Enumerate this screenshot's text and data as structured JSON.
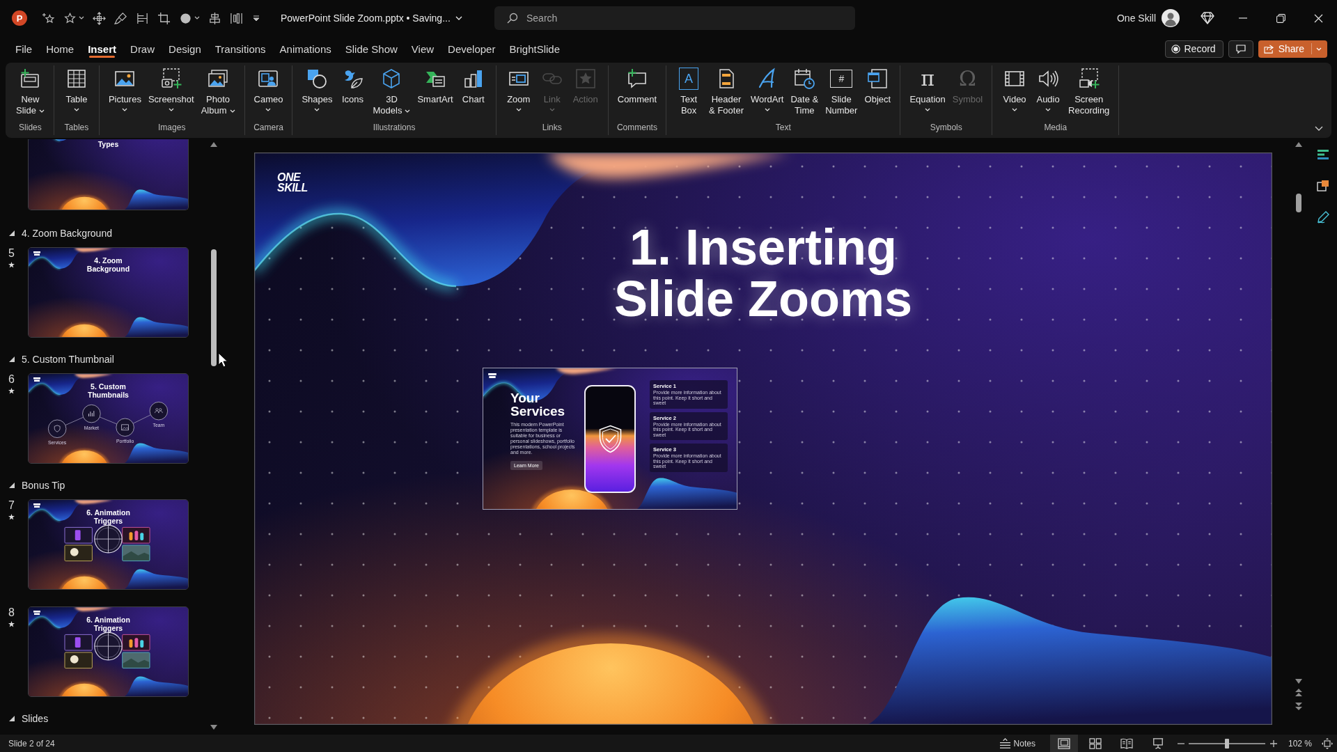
{
  "title_bar": {
    "app_logo": "P",
    "document_title": "PowerPoint Slide Zoom.pptx • Saving...",
    "search": {
      "placeholder": "Search"
    },
    "account_name": "One Skill"
  },
  "ribbon_tabs": [
    {
      "label": "File",
      "selected": false
    },
    {
      "label": "Home",
      "selected": false
    },
    {
      "label": "Insert",
      "selected": true
    },
    {
      "label": "Draw",
      "selected": false
    },
    {
      "label": "Design",
      "selected": false
    },
    {
      "label": "Transitions",
      "selected": false
    },
    {
      "label": "Animations",
      "selected": false
    },
    {
      "label": "Slide Show",
      "selected": false
    },
    {
      "label": "View",
      "selected": false
    },
    {
      "label": "Developer",
      "selected": false
    },
    {
      "label": "BrightSlide",
      "selected": false
    }
  ],
  "ribbon_actions": {
    "record": "Record",
    "share": "Share"
  },
  "ribbon": {
    "groups": [
      {
        "label": "Slides",
        "buttons": [
          {
            "kind": "newslide",
            "lines": [
              "New",
              "Slide"
            ],
            "dropdown": true,
            "disabled": false
          }
        ]
      },
      {
        "label": "Tables",
        "buttons": [
          {
            "kind": "table",
            "lines": [
              "Table"
            ],
            "dropdown": true,
            "disabled": false
          }
        ]
      },
      {
        "label": "Images",
        "buttons": [
          {
            "kind": "pictures",
            "lines": [
              "Pictures"
            ],
            "dropdown": true,
            "disabled": false
          },
          {
            "kind": "screenshot",
            "lines": [
              "Screenshot"
            ],
            "dropdown": true,
            "disabled": false
          },
          {
            "kind": "album",
            "lines": [
              "Photo",
              "Album"
            ],
            "dropdown": true,
            "disabled": false
          }
        ]
      },
      {
        "label": "Camera",
        "buttons": [
          {
            "kind": "cameo",
            "lines": [
              "Cameo"
            ],
            "dropdown": true,
            "disabled": false
          }
        ]
      },
      {
        "label": "Illustrations",
        "buttons": [
          {
            "kind": "shapes",
            "lines": [
              "Shapes"
            ],
            "dropdown": true,
            "disabled": false
          },
          {
            "kind": "icons",
            "lines": [
              "Icons"
            ],
            "dropdown": false,
            "disabled": false
          },
          {
            "kind": "models",
            "lines": [
              "3D",
              "Models"
            ],
            "dropdown": true,
            "disabled": false
          },
          {
            "kind": "smartart",
            "lines": [
              "SmartArt"
            ],
            "dropdown": false,
            "disabled": false
          },
          {
            "kind": "chart",
            "lines": [
              "Chart"
            ],
            "dropdown": false,
            "disabled": false
          }
        ]
      },
      {
        "label": "Links",
        "buttons": [
          {
            "kind": "zoom",
            "lines": [
              "Zoom"
            ],
            "dropdown": true,
            "disabled": false
          },
          {
            "kind": "link",
            "lines": [
              "Link"
            ],
            "dropdown": true,
            "disabled": true
          },
          {
            "kind": "action",
            "lines": [
              "Action"
            ],
            "dropdown": false,
            "disabled": true
          }
        ]
      },
      {
        "label": "Comments",
        "buttons": [
          {
            "kind": "comment",
            "lines": [
              "Comment"
            ],
            "dropdown": false,
            "disabled": false
          }
        ]
      },
      {
        "label": "Text",
        "buttons": [
          {
            "kind": "textbox",
            "glyph": "A",
            "lines": [
              "Text",
              "Box"
            ],
            "dropdown": false,
            "disabled": false
          },
          {
            "kind": "header",
            "lines": [
              "Header",
              "& Footer"
            ],
            "dropdown": false,
            "disabled": false
          },
          {
            "kind": "wordart",
            "lines": [
              "WordArt"
            ],
            "dropdown": true,
            "disabled": false
          },
          {
            "kind": "datetime",
            "lines": [
              "Date &",
              "Time"
            ],
            "dropdown": false,
            "disabled": false
          },
          {
            "kind": "slidenumber",
            "glyph": "#",
            "lines": [
              "Slide",
              "Number"
            ],
            "dropdown": false,
            "disabled": false
          },
          {
            "kind": "object",
            "lines": [
              "Object"
            ],
            "dropdown": false,
            "disabled": false
          }
        ]
      },
      {
        "label": "Symbols",
        "buttons": [
          {
            "kind": "equation",
            "glyph": "π",
            "lines": [
              "Equation"
            ],
            "dropdown": true,
            "disabled": false
          },
          {
            "kind": "symbol",
            "glyph": "Ω",
            "lines": [
              "Symbol"
            ],
            "dropdown": false,
            "disabled": true
          }
        ]
      },
      {
        "label": "Media",
        "buttons": [
          {
            "kind": "video",
            "lines": [
              "Video"
            ],
            "dropdown": true,
            "disabled": false
          },
          {
            "kind": "audio",
            "lines": [
              "Audio"
            ],
            "dropdown": true,
            "disabled": false
          },
          {
            "kind": "recording",
            "lines": [
              "Screen",
              "Recording"
            ],
            "dropdown": false,
            "disabled": false
          }
        ]
      }
    ]
  },
  "slide_panel": {
    "top_slide": {
      "title": "Types",
      "selected": false
    },
    "sections": [
      {
        "title": "4. Zoom Background",
        "expanded": true,
        "slides": [
          {
            "number": "5",
            "animated": true,
            "selected": false,
            "kind": "title",
            "title": "4. Zoom Background"
          }
        ]
      },
      {
        "title": "5. Custom Thumbnail",
        "expanded": true,
        "slides": [
          {
            "number": "6",
            "animated": true,
            "selected": false,
            "kind": "nodes",
            "title": "5. Custom Thumbnails",
            "nodes": [
              "Services",
              "Market",
              "Portfolio",
              "Team"
            ]
          }
        ]
      },
      {
        "title": "Bonus Tip",
        "expanded": true,
        "slides": [
          {
            "number": "7",
            "animated": true,
            "selected": false,
            "kind": "grid",
            "title": "6. Animation Triggers"
          },
          {
            "number": "8",
            "animated": true,
            "selected": false,
            "kind": "grid",
            "title": "6. Animation Triggers"
          }
        ]
      },
      {
        "title": "Slides",
        "expanded": true
      }
    ]
  },
  "slide": {
    "logo": "ONE SKILL",
    "title": "1. Inserting Slide Zooms",
    "slide_zoom": {
      "heading": "Your Services",
      "description": "This modern PowerPoint presentation template is suitable for business or personal slideshows, portfolio presentations, school projects and more.",
      "button": "Learn More",
      "services": [
        {
          "title": "Service 1",
          "text": "Provide more information about this point. Keep it short and sweet"
        },
        {
          "title": "Service 2",
          "text": "Provide more information about this point. Keep it short and sweet"
        },
        {
          "title": "Service 3",
          "text": "Provide more information about this point. Keep it short and sweet"
        }
      ]
    }
  },
  "status_bar": {
    "slide_position": "Slide 2 of 24",
    "notes": "Notes",
    "views": [
      {
        "kind": "normal",
        "selected": true
      },
      {
        "kind": "sorter",
        "selected": false
      },
      {
        "kind": "reading",
        "selected": false
      },
      {
        "kind": "slideshow",
        "selected": false
      }
    ],
    "zoom": {
      "level": 0.5,
      "reading": "102 %"
    }
  }
}
